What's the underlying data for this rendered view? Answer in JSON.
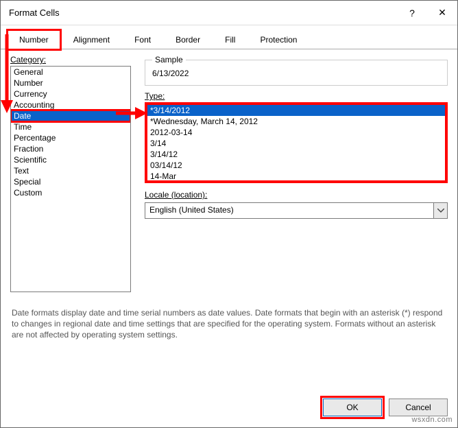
{
  "dialog": {
    "title": "Format Cells",
    "help_icon": "?",
    "close_icon": "✕"
  },
  "tabs": [
    {
      "label": "Number",
      "active": true
    },
    {
      "label": "Alignment",
      "active": false
    },
    {
      "label": "Font",
      "active": false
    },
    {
      "label": "Border",
      "active": false
    },
    {
      "label": "Fill",
      "active": false
    },
    {
      "label": "Protection",
      "active": false
    }
  ],
  "category": {
    "label": "Category:",
    "items": [
      "General",
      "Number",
      "Currency",
      "Accounting",
      "Date",
      "Time",
      "Percentage",
      "Fraction",
      "Scientific",
      "Text",
      "Special",
      "Custom"
    ],
    "selected_index": 4
  },
  "sample": {
    "legend": "Sample",
    "value": "6/13/2022"
  },
  "type": {
    "label": "Type:",
    "items": [
      "*3/14/2012",
      "*Wednesday, March 14, 2012",
      "2012-03-14",
      "3/14",
      "3/14/12",
      "03/14/12",
      "14-Mar"
    ],
    "selected_index": 0
  },
  "locale": {
    "label": "Locale (location):",
    "value": "English (United States)"
  },
  "description": "Date formats display date and time serial numbers as date values.  Date formats that begin with an asterisk (*) respond to changes in regional date and time settings that are specified for the operating system.  Formats without an asterisk are not affected by operating system settings.",
  "buttons": {
    "ok": "OK",
    "cancel": "Cancel"
  },
  "watermark": "wsxdn.com"
}
